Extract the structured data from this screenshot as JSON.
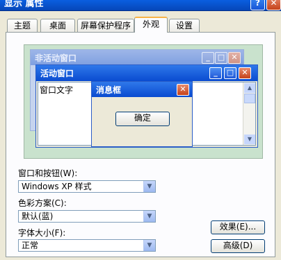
{
  "window": {
    "title": "显示 属性",
    "help_btn": "?",
    "close_btn": "✕"
  },
  "tabs": [
    {
      "label": "主题"
    },
    {
      "label": "桌面"
    },
    {
      "label": "屏幕保护程序"
    },
    {
      "label": "外观"
    },
    {
      "label": "设置"
    }
  ],
  "preview": {
    "inactive_title": "非活动窗口",
    "active_title": "活动窗口",
    "window_text": "窗口文字",
    "msgbox_title": "消息框",
    "ok_label": "确定",
    "min_glyph": "_",
    "max_glyph": "□",
    "close_glyph": "✕"
  },
  "form": {
    "windows_buttons_label": "窗口和按钮(W):",
    "windows_buttons_value": "Windows XP 样式",
    "color_scheme_label": "色彩方案(C):",
    "color_scheme_value": "默认(蓝)",
    "font_size_label": "字体大小(F):",
    "font_size_value": "正常",
    "effects_button": "效果(E)...",
    "advanced_button": "高级(D)",
    "dropdown_glyph": "▼"
  }
}
